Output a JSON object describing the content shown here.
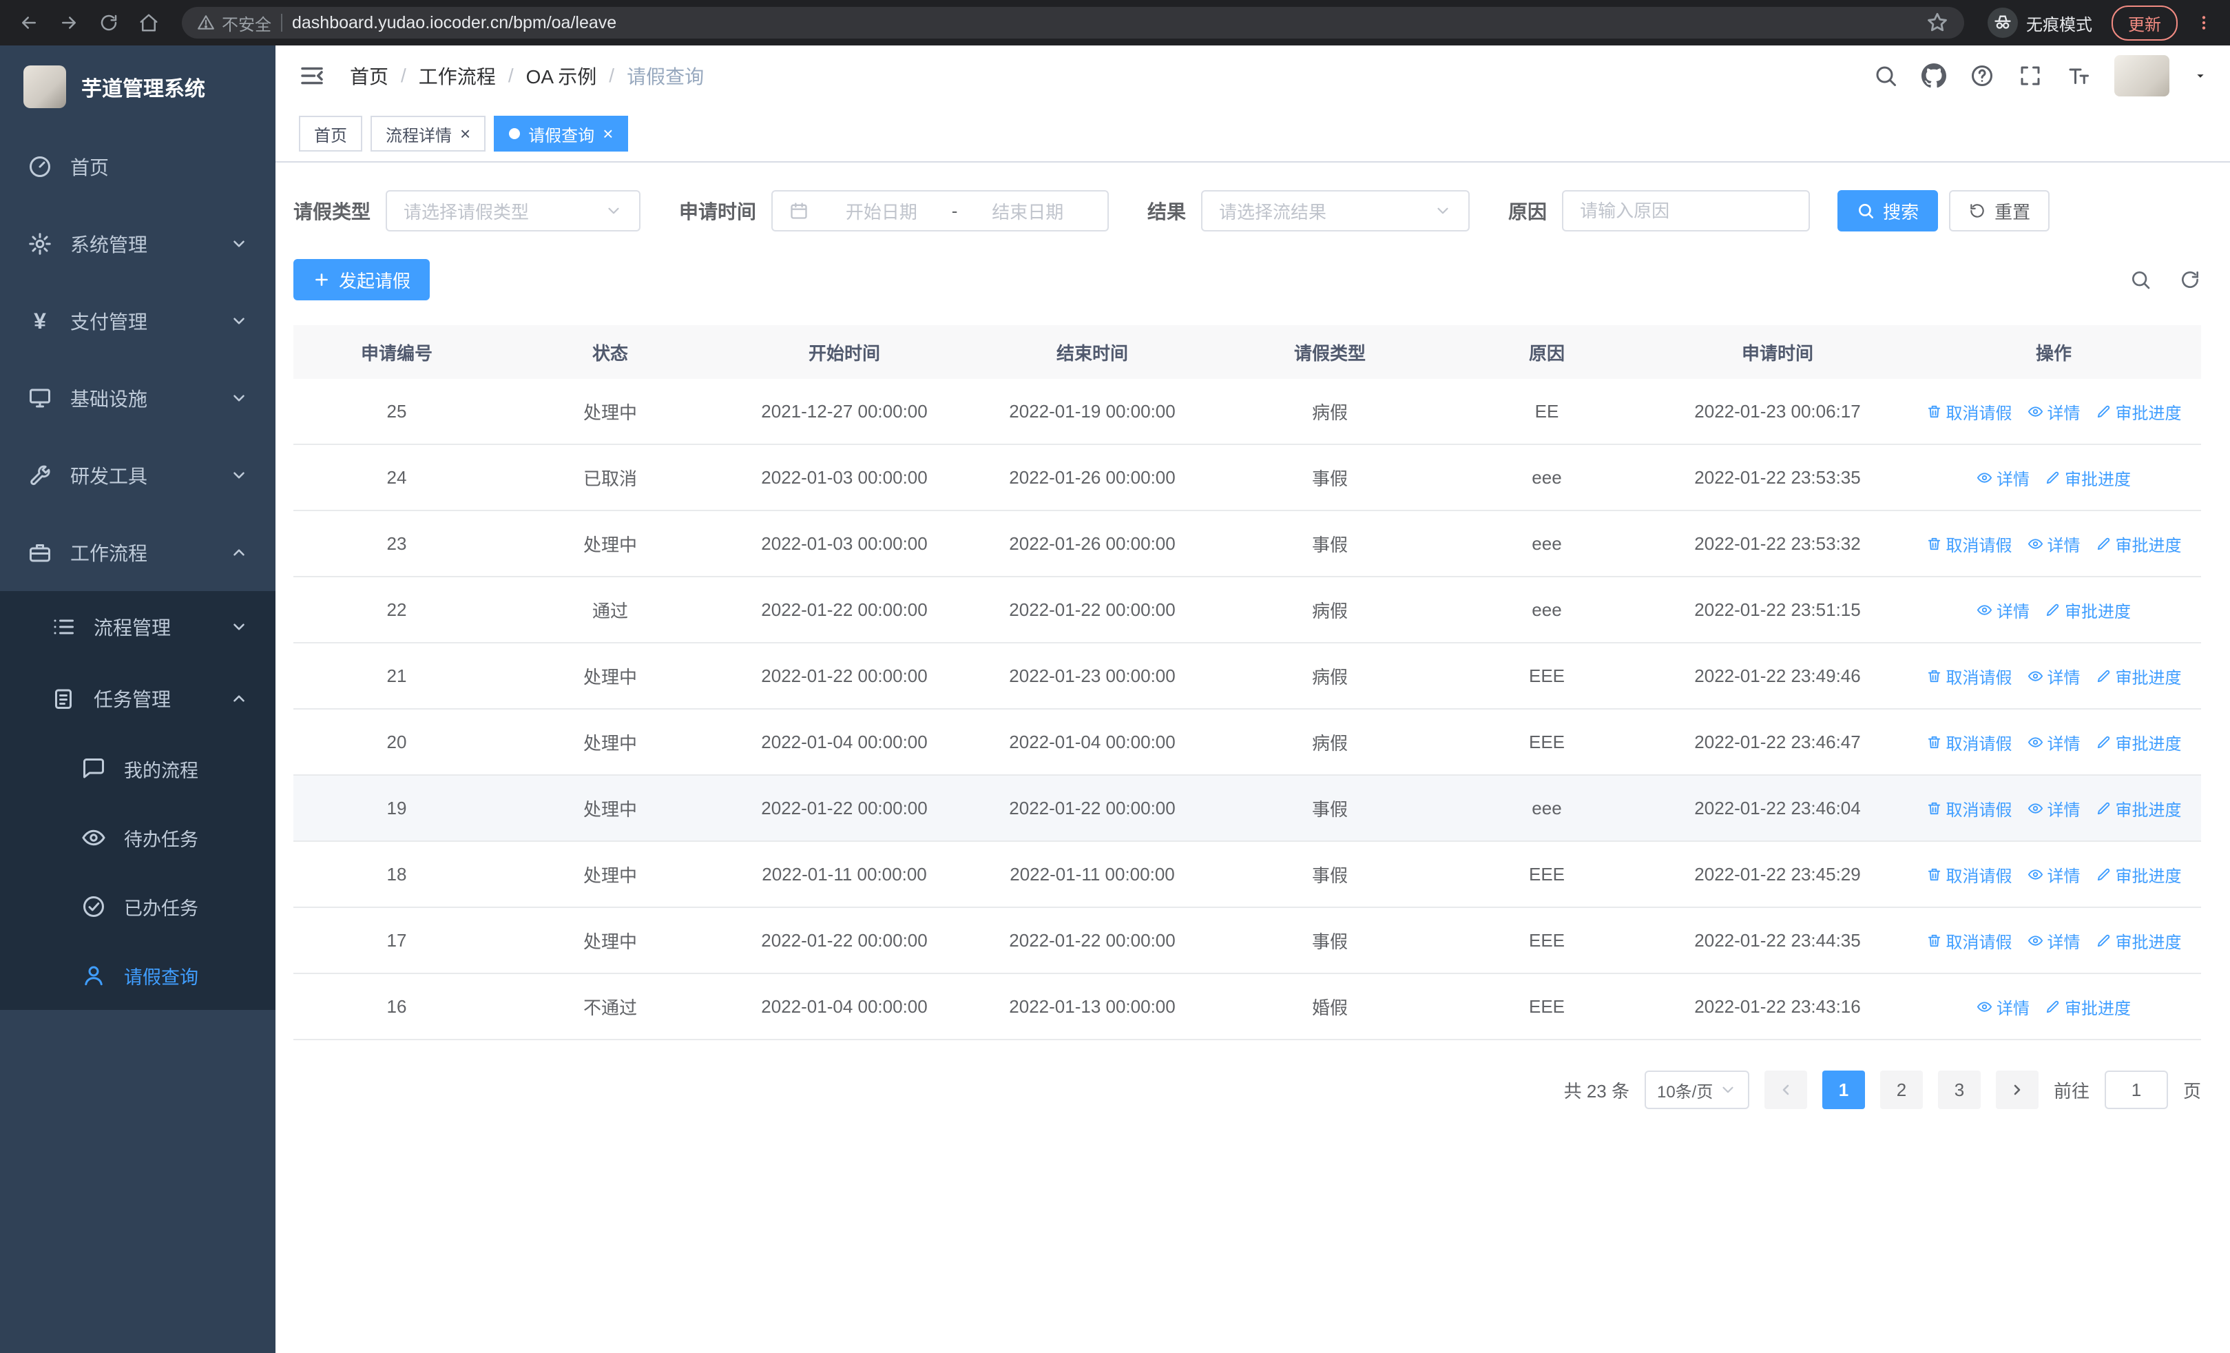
{
  "colors": {
    "accent": "#409eff",
    "sidebar_bg": "#304156",
    "submenu_bg": "#1f2d3d",
    "danger": "#f28b82"
  },
  "ui": {
    "close_glyph": "×"
  },
  "icons": {
    "yen": "¥"
  },
  "browser": {
    "security_warning": "不安全",
    "url": "dashboard.yudao.iocoder.cn/bpm/oa/leave",
    "incognito_label": "无痕模式",
    "update_label": "更新"
  },
  "sidebar": {
    "logo_title": "芋道管理系统",
    "items": [
      {
        "label": "首页"
      },
      {
        "label": "系统管理"
      },
      {
        "label": "支付管理"
      },
      {
        "label": "基础设施"
      },
      {
        "label": "研发工具"
      },
      {
        "label": "工作流程"
      }
    ],
    "workflow_children": [
      {
        "label": "流程管理"
      },
      {
        "label": "任务管理"
      }
    ],
    "task_children": [
      {
        "label": "我的流程"
      },
      {
        "label": "待办任务"
      },
      {
        "label": "已办任务"
      },
      {
        "label": "请假查询"
      }
    ]
  },
  "navbar": {
    "breadcrumb": [
      "首页",
      "工作流程",
      "OA 示例",
      "请假查询"
    ]
  },
  "tabs": [
    {
      "label": "首页"
    },
    {
      "label": "流程详情"
    },
    {
      "label": "请假查询"
    }
  ],
  "filters": {
    "leave_type_label": "请假类型",
    "leave_type_placeholder": "请选择请假类型",
    "apply_time_label": "申请时间",
    "start_placeholder": "开始日期",
    "range_separator": "-",
    "end_placeholder": "结束日期",
    "result_label": "结果",
    "result_placeholder": "请选择流结果",
    "reason_label": "原因",
    "reason_placeholder": "请输入原因",
    "search_label": "搜索",
    "reset_label": "重置"
  },
  "toolbar": {
    "create_label": "发起请假"
  },
  "table": {
    "columns": [
      "申请编号",
      "状态",
      "开始时间",
      "结束时间",
      "请假类型",
      "原因",
      "申请时间",
      "操作"
    ],
    "actions": {
      "cancel": "取消请假",
      "detail": "详情",
      "progress": "审批进度"
    },
    "rows": [
      {
        "id": "25",
        "status": "处理中",
        "start_time": "2021-12-27 00:00:00",
        "end_time": "2022-01-19 00:00:00",
        "leave_type": "病假",
        "reason": "EE",
        "apply_time": "2022-01-23 00:06:17",
        "cancellable": true,
        "hover": false
      },
      {
        "id": "24",
        "status": "已取消",
        "start_time": "2022-01-03 00:00:00",
        "end_time": "2022-01-26 00:00:00",
        "leave_type": "事假",
        "reason": "eee",
        "apply_time": "2022-01-22 23:53:35",
        "cancellable": false,
        "hover": false
      },
      {
        "id": "23",
        "status": "处理中",
        "start_time": "2022-01-03 00:00:00",
        "end_time": "2022-01-26 00:00:00",
        "leave_type": "事假",
        "reason": "eee",
        "apply_time": "2022-01-22 23:53:32",
        "cancellable": true,
        "hover": false
      },
      {
        "id": "22",
        "status": "通过",
        "start_time": "2022-01-22 00:00:00",
        "end_time": "2022-01-22 00:00:00",
        "leave_type": "病假",
        "reason": "eee",
        "apply_time": "2022-01-22 23:51:15",
        "cancellable": false,
        "hover": false
      },
      {
        "id": "21",
        "status": "处理中",
        "start_time": "2022-01-22 00:00:00",
        "end_time": "2022-01-23 00:00:00",
        "leave_type": "病假",
        "reason": "EEE",
        "apply_time": "2022-01-22 23:49:46",
        "cancellable": true,
        "hover": false
      },
      {
        "id": "20",
        "status": "处理中",
        "start_time": "2022-01-04 00:00:00",
        "end_time": "2022-01-04 00:00:00",
        "leave_type": "病假",
        "reason": "EEE",
        "apply_time": "2022-01-22 23:46:47",
        "cancellable": true,
        "hover": false
      },
      {
        "id": "19",
        "status": "处理中",
        "start_time": "2022-01-22 00:00:00",
        "end_time": "2022-01-22 00:00:00",
        "leave_type": "事假",
        "reason": "eee",
        "apply_time": "2022-01-22 23:46:04",
        "cancellable": true,
        "hover": true
      },
      {
        "id": "18",
        "status": "处理中",
        "start_time": "2022-01-11 00:00:00",
        "end_time": "2022-01-11 00:00:00",
        "leave_type": "事假",
        "reason": "EEE",
        "apply_time": "2022-01-22 23:45:29",
        "cancellable": true,
        "hover": false
      },
      {
        "id": "17",
        "status": "处理中",
        "start_time": "2022-01-22 00:00:00",
        "end_time": "2022-01-22 00:00:00",
        "leave_type": "事假",
        "reason": "EEE",
        "apply_time": "2022-01-22 23:44:35",
        "cancellable": true,
        "hover": false
      },
      {
        "id": "16",
        "status": "不通过",
        "start_time": "2022-01-04 00:00:00",
        "end_time": "2022-01-13 00:00:00",
        "leave_type": "婚假",
        "reason": "EEE",
        "apply_time": "2022-01-22 23:43:16",
        "cancellable": false,
        "hover": false
      }
    ]
  },
  "pagination": {
    "total_text": "共 23 条",
    "page_size": "10条/页",
    "pages": [
      "1",
      "2",
      "3"
    ],
    "active_page": "1",
    "goto_prefix": "前往",
    "goto_value": "1",
    "goto_suffix": "页"
  }
}
